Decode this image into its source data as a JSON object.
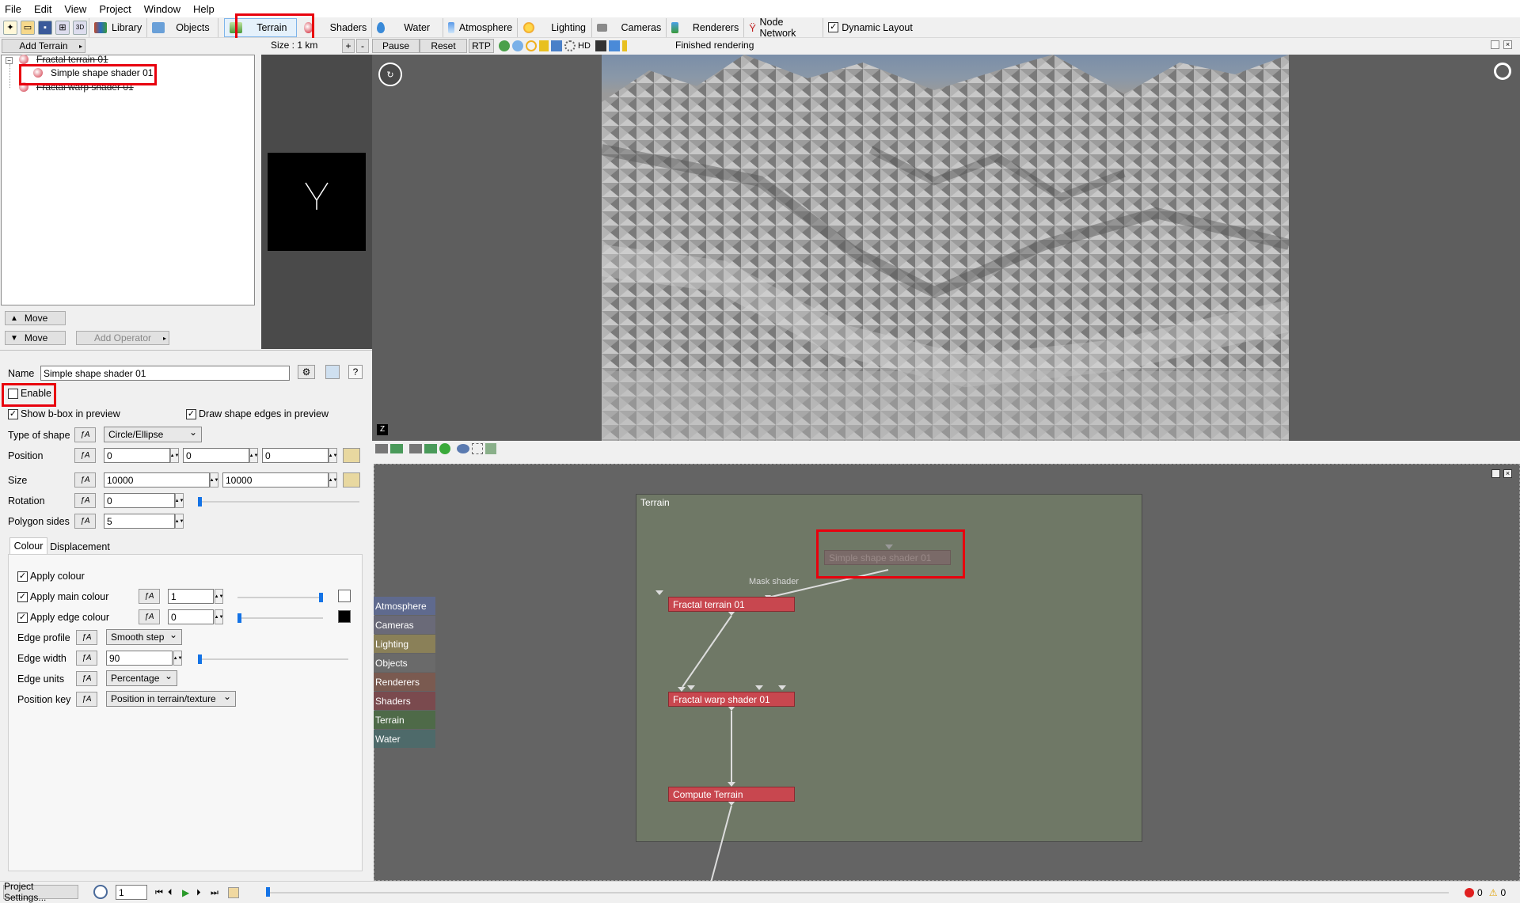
{
  "menu": [
    "File",
    "Edit",
    "View",
    "Project",
    "Window",
    "Help"
  ],
  "toolbar": {
    "library": "Library",
    "objects": "Objects",
    "terrain": "Terrain",
    "shaders": "Shaders",
    "water": "Water",
    "atmosphere": "Atmosphere",
    "lighting": "Lighting",
    "cameras": "Cameras",
    "renderers": "Renderers",
    "node_network": "Node Network",
    "dynamic_layout": "Dynamic Layout"
  },
  "row2": {
    "add_terrain": "Add Terrain",
    "size": "Size : 1 km",
    "plus": "+",
    "minus": "-",
    "pause": "Pause",
    "reset": "Reset",
    "rtp": "RTP",
    "hd": "HD",
    "status": "Finished rendering"
  },
  "tree": {
    "items": [
      "Fractal terrain 01",
      "Simple shape shader 01",
      "Fractal warp shader 01"
    ]
  },
  "tree_buttons": {
    "move_up": "Move",
    "move_down": "Move",
    "add_operator": "Add Operator"
  },
  "props": {
    "name_label": "Name",
    "name_value": "Simple shape shader 01",
    "enable": "Enable",
    "show_bbox": "Show b-box in preview",
    "draw_edges": "Draw shape edges in preview",
    "type_label": "Type of shape",
    "type_value": "Circle/Ellipse",
    "position_label": "Position",
    "pos_x": "0",
    "pos_y": "0",
    "pos_z": "0",
    "size_label": "Size",
    "size_x": "10000",
    "size_y": "10000",
    "rotation_label": "Rotation",
    "rotation_value": "0",
    "polygon_label": "Polygon sides",
    "polygon_value": "5",
    "tab_colour": "Colour",
    "tab_displacement": "Displacement",
    "apply_colour": "Apply colour",
    "apply_main": "Apply main colour",
    "main_value": "1",
    "apply_edge": "Apply edge colour",
    "edge_value": "0",
    "edge_profile_label": "Edge profile",
    "edge_profile_value": "Smooth step",
    "edge_width_label": "Edge width",
    "edge_width_value": "90",
    "edge_units_label": "Edge units",
    "edge_units_value": "Percentage",
    "position_key_label": "Position key",
    "position_key_value": "Position in terrain/texture"
  },
  "graph": {
    "group_title": "Terrain",
    "nodes": {
      "simple_shape": "Simple shape shader 01",
      "mask_label": "Mask shader",
      "fractal_terrain": "Fractal terrain 01",
      "fractal_warp": "Fractal warp shader 01",
      "compute_terrain": "Compute Terrain"
    },
    "categories": [
      {
        "label": "Atmosphere",
        "color": "#5f6a8e"
      },
      {
        "label": "Cameras",
        "color": "#6a6a78"
      },
      {
        "label": "Lighting",
        "color": "#8a8058"
      },
      {
        "label": "Objects",
        "color": "#6a6a6a"
      },
      {
        "label": "Renderers",
        "color": "#7a5a50"
      },
      {
        "label": "Shaders",
        "color": "#7a4a4e"
      },
      {
        "label": "Terrain",
        "color": "#4e6a48"
      },
      {
        "label": "Water",
        "color": "#4e6a6a"
      }
    ]
  },
  "statusbar": {
    "project_settings": "Project Settings...",
    "frame": "1",
    "errors": "0",
    "warnings": "0"
  }
}
